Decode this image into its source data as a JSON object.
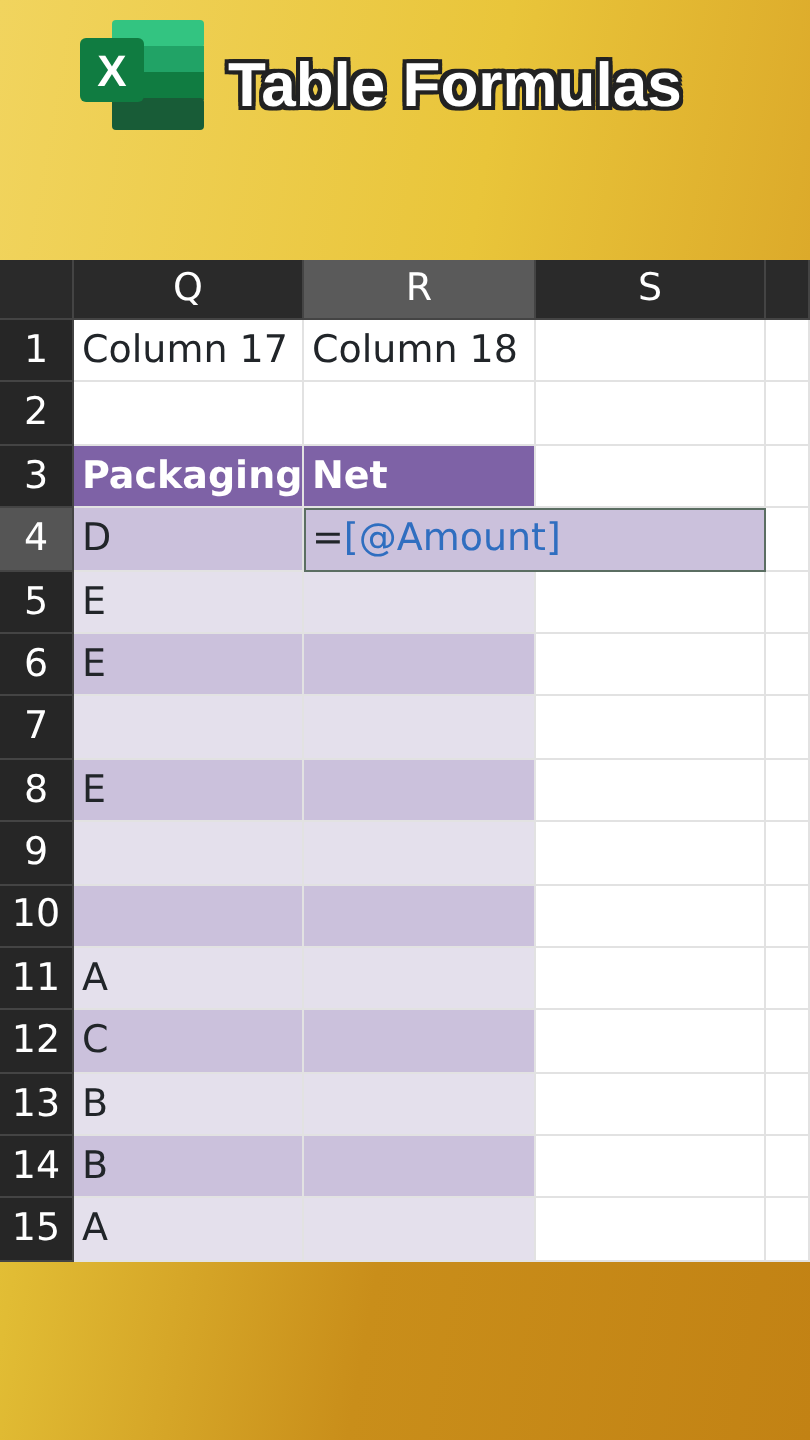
{
  "banner": {
    "logo_letter": "X",
    "title": "Table Formulas"
  },
  "columns": [
    {
      "label": "Q",
      "selected": false
    },
    {
      "label": "R",
      "selected": true
    },
    {
      "label": "S",
      "selected": false
    }
  ],
  "rows": [
    {
      "number": "1",
      "kind": "plain",
      "selected": false,
      "cells": [
        {
          "text": "Column 17",
          "editing": false
        },
        {
          "text": "Column 18",
          "editing": false
        }
      ]
    },
    {
      "number": "2",
      "kind": "plain",
      "selected": false
    },
    {
      "number": "3",
      "kind": "table-header",
      "selected": false,
      "cells": [
        {
          "text": "Packaging",
          "editing": false
        },
        {
          "text": "Net",
          "editing": false
        }
      ]
    },
    {
      "number": "4",
      "kind": "band-dark",
      "selected": true,
      "cells": [
        {
          "text": "D",
          "editing": false
        },
        {
          "text": "=",
          "reference": "[@Amount]",
          "editing": true
        }
      ]
    },
    {
      "number": "5",
      "kind": "band-light",
      "selected": false,
      "cells": [
        {
          "text": "E",
          "editing": false
        }
      ]
    },
    {
      "number": "6",
      "kind": "band-dark",
      "selected": false,
      "cells": [
        {
          "text": "E",
          "editing": false
        }
      ]
    },
    {
      "number": "7",
      "kind": "band-light",
      "selected": false
    },
    {
      "number": "8",
      "kind": "band-dark",
      "selected": false,
      "cells": [
        {
          "text": "E",
          "editing": false
        }
      ]
    },
    {
      "number": "9",
      "kind": "band-light",
      "selected": false
    },
    {
      "number": "10",
      "kind": "band-dark",
      "selected": false
    },
    {
      "number": "11",
      "kind": "band-light",
      "selected": false,
      "cells": [
        {
          "text": "A",
          "editing": false
        }
      ]
    },
    {
      "number": "12",
      "kind": "band-dark",
      "selected": false,
      "cells": [
        {
          "text": "C",
          "editing": false
        }
      ]
    },
    {
      "number": "13",
      "kind": "band-light",
      "selected": false,
      "cells": [
        {
          "text": "B",
          "editing": false
        }
      ]
    },
    {
      "number": "14",
      "kind": "band-dark",
      "selected": false,
      "cells": [
        {
          "text": "B",
          "editing": false
        }
      ]
    },
    {
      "number": "15",
      "kind": "band-light",
      "selected": false,
      "cells": [
        {
          "text": "A",
          "editing": false
        }
      ]
    }
  ]
}
